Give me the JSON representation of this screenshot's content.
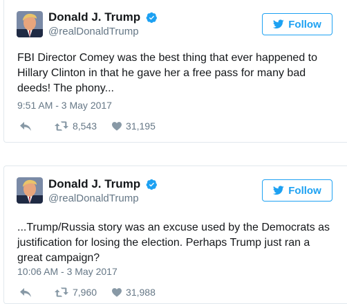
{
  "tweets": [
    {
      "name": "Donald J. Trump",
      "handle": "@realDonaldTrump",
      "follow_label": "Follow",
      "text": "FBI Director Comey was the best thing that ever happened to Hillary Clinton in that he gave her a free pass for many bad deeds! The phony...",
      "timestamp": "9:51 AM - 3 May 2017",
      "retweets": "8,543",
      "likes": "31,195"
    },
    {
      "name": "Donald J. Trump",
      "handle": "@realDonaldTrump",
      "follow_label": "Follow",
      "text": "...Trump/Russia story was an excuse used by the Democrats as justification for losing the election. Perhaps Trump just ran a great campaign?",
      "timestamp": "10:06 AM - 3 May 2017",
      "retweets": "7,960",
      "likes": "31,988"
    }
  ],
  "colors": {
    "accent": "#1da1f2",
    "secondary_text": "#657786",
    "border": "#e1e8ed"
  },
  "icons": [
    "avatar",
    "verified-badge-icon",
    "twitter-bird-icon",
    "reply-icon",
    "retweet-icon",
    "heart-icon"
  ]
}
